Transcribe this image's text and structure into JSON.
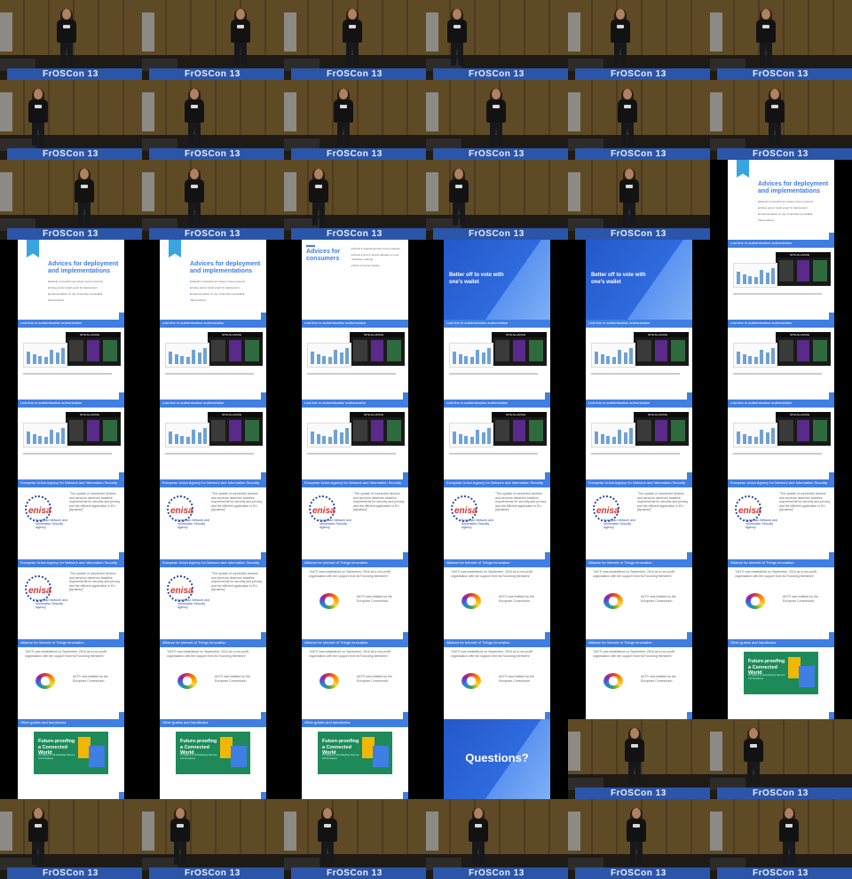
{
  "layout": {
    "columns": 6,
    "rows": 11
  },
  "colors": {
    "accent_blue": "#3f7ee3",
    "stage_brown": "#5a4828",
    "banner_blue": "#2b55a8",
    "enisa_red": "#d8322e"
  },
  "banner_text": "FrOSCon 13",
  "slides": {
    "deployment": {
      "title": "Advices for deployment and implementations",
      "bullets": [
        "Default to transformers where secure security",
        "Giving secret crash-proof for deployment",
        "Implementation on top of security use-default frameworkers"
      ]
    },
    "consumers": {
      "title": "Advices for consumers",
      "bullets": [
        "Check if regular/security comes updates",
        "Check if an IoT device defaults to most restrictive settings",
        "Think of secure setting"
      ]
    },
    "wallet": {
      "title": "Better off to vote with one's wallet"
    },
    "last_line": {
      "header": "Last line in authentication authorization",
      "site_title": "NITE ALLIANCE"
    },
    "enisa": {
      "header": "European Union Agency for Network and Information Security",
      "logo_text": "enisa",
      "logo_sub": "European Network and Information Security Agency",
      "quote": "\"The update of connected devices and services deserves baseline requirements for security and privacy and the efficient application in EU [dynamic]\""
    },
    "aioti": {
      "header": "Alliance for Internet of Things Innovation",
      "quote": "\"AIOTI was established on September, 2016 as a non-profit organisation with the support from its Founding Members\"",
      "side": "AIOTI was initiated by the European Commission"
    },
    "guides": {
      "header": "Other guides and handbooks",
      "cover_title": "Future-proofing a Connected World",
      "cover_sub": "13 Steps to Developing Secure IoT Products"
    },
    "questions": {
      "title": "Questions?"
    }
  },
  "tiles": [
    {
      "kind": "frame",
      "x": 62
    },
    {
      "kind": "frame",
      "x": 98
    },
    {
      "kind": "frame",
      "x": 64
    },
    {
      "kind": "frame",
      "x": 22
    },
    {
      "kind": "frame",
      "x": 46
    },
    {
      "kind": "frame",
      "x": 50
    },
    {
      "kind": "frame",
      "x": 30
    },
    {
      "kind": "frame",
      "x": 46
    },
    {
      "kind": "frame",
      "x": 54
    },
    {
      "kind": "frame",
      "x": 66
    },
    {
      "kind": "frame",
      "x": 54
    },
    {
      "kind": "frame",
      "x": 60
    },
    {
      "kind": "frame",
      "x": 82
    },
    {
      "kind": "frame",
      "x": 46
    },
    {
      "kind": "frame",
      "x": 26
    },
    {
      "kind": "frame",
      "x": 24
    },
    {
      "kind": "frame",
      "x": 56
    },
    {
      "kind": "deployment"
    },
    {
      "kind": "deployment"
    },
    {
      "kind": "deployment"
    },
    {
      "kind": "consumers"
    },
    {
      "kind": "wallet"
    },
    {
      "kind": "wallet"
    },
    {
      "kind": "last_line"
    },
    {
      "kind": "last_line"
    },
    {
      "kind": "last_line"
    },
    {
      "kind": "last_line"
    },
    {
      "kind": "last_line"
    },
    {
      "kind": "last_line"
    },
    {
      "kind": "last_line"
    },
    {
      "kind": "last_line"
    },
    {
      "kind": "last_line"
    },
    {
      "kind": "last_line"
    },
    {
      "kind": "last_line"
    },
    {
      "kind": "last_line"
    },
    {
      "kind": "last_line"
    },
    {
      "kind": "enisa"
    },
    {
      "kind": "enisa"
    },
    {
      "kind": "enisa"
    },
    {
      "kind": "enisa"
    },
    {
      "kind": "enisa"
    },
    {
      "kind": "enisa"
    },
    {
      "kind": "enisa"
    },
    {
      "kind": "enisa"
    },
    {
      "kind": "aioti"
    },
    {
      "kind": "aioti"
    },
    {
      "kind": "aioti"
    },
    {
      "kind": "aioti"
    },
    {
      "kind": "aioti"
    },
    {
      "kind": "aioti"
    },
    {
      "kind": "aioti"
    },
    {
      "kind": "aioti"
    },
    {
      "kind": "aioti"
    },
    {
      "kind": "guides"
    },
    {
      "kind": "guides"
    },
    {
      "kind": "guides"
    },
    {
      "kind": "guides"
    },
    {
      "kind": "questions"
    },
    {
      "kind": "frame",
      "x": 62
    },
    {
      "kind": "frame",
      "x": 36
    },
    {
      "kind": "frame",
      "x": 30
    },
    {
      "kind": "frame",
      "x": 30
    },
    {
      "kind": "frame",
      "x": 36
    },
    {
      "kind": "frame",
      "x": 46
    },
    {
      "kind": "frame",
      "x": 64
    },
    {
      "kind": "frame",
      "x": 76
    }
  ]
}
